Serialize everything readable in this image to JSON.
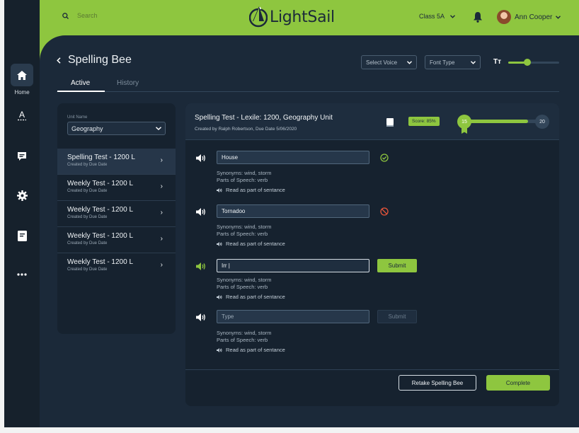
{
  "colors": {
    "accent": "#8ec63f",
    "dark": "#1b2939",
    "rail": "#16212c",
    "error": "#e8553a"
  },
  "sidebar": {
    "home_label": "Home",
    "items": [
      {
        "icon": "home-icon",
        "label": "Home"
      },
      {
        "icon": "spelling-icon"
      },
      {
        "icon": "chat-icon"
      },
      {
        "icon": "gear-icon"
      },
      {
        "icon": "notebook-icon"
      },
      {
        "icon": "more-icon"
      }
    ]
  },
  "header": {
    "search_placeholder": "Search",
    "logo": "LightSail",
    "class_select": "Class 5A",
    "user_name": "Ann Cooper"
  },
  "page": {
    "title": "Spelling Bee",
    "tabs": [
      {
        "label": "Active",
        "active": true
      },
      {
        "label": "History",
        "active": false
      }
    ],
    "voice_select": "Select Voice",
    "font_select": "Font Type",
    "text_size_icon": "Tт",
    "text_size_level": 0.38
  },
  "left_panel": {
    "unit_label": "Unit Name",
    "unit_value": "Geography",
    "tests": [
      {
        "title": "Spelling Test - 1200 L",
        "sub": "Created by Due Date",
        "selected": true
      },
      {
        "title": "Weekly Test - 1200 L",
        "sub": "Created by Due Date"
      },
      {
        "title": "Weekly Test - 1200 L",
        "sub": "Created by Due Date"
      },
      {
        "title": "Weekly Test - 1200 L",
        "sub": "Created by Due Date"
      },
      {
        "title": "Weekly Test - 1200 L",
        "sub": "Created by Due Date"
      }
    ]
  },
  "test": {
    "title": "Spelling  Test - Lexile: 1200, Geography Unit",
    "subtitle": "Created by Ralph Robertson, Due Date 5/06/2020",
    "score": "Score: 85%",
    "progress_current": "15",
    "progress_total": "20",
    "progress_fraction": 0.75,
    "words": [
      {
        "value": "House",
        "placeholder": "",
        "status": "correct",
        "synonyms": "Synonyms: wind, storm",
        "pos": "Parts of Speech: verb",
        "read": "Read as part of sentance"
      },
      {
        "value": "Tornadoo",
        "placeholder": "",
        "status": "wrong",
        "synonyms": "Synonyms: wind, storm",
        "pos": "Parts of Speech: verb",
        "read": "Read as part of sentance"
      },
      {
        "value": "Irr |",
        "placeholder": "",
        "status": "active",
        "button": "Submit",
        "synonyms": "Synonyms: wind, storm",
        "pos": "Parts of Speech: verb",
        "read": "Read as part of sentance"
      },
      {
        "value": "",
        "placeholder": "Type",
        "status": "pending",
        "button": "Submit",
        "synonyms": "Synonyms: wind, storm",
        "pos": "Parts of Speech: verb",
        "read": "Read as part of sentance"
      }
    ],
    "retake_label": "Retake Spelling Bee",
    "complete_label": "Complete"
  }
}
